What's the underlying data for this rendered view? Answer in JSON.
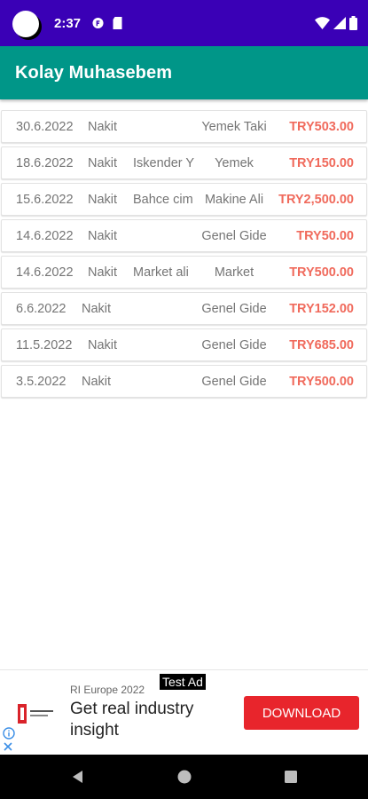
{
  "status_bar": {
    "time": "2:37",
    "icons": [
      "avatar",
      "circle-f-icon",
      "sd-card-icon",
      "wifi-icon",
      "signal-icon",
      "battery-icon"
    ]
  },
  "app_bar": {
    "title": "Kolay Muhasebem",
    "background": "#009688"
  },
  "transactions": [
    {
      "date": "30.6.2022",
      "type": "Nakit",
      "description": "",
      "category": "Yemek Taki",
      "amount": "TRY503.00"
    },
    {
      "date": "18.6.2022",
      "type": "Nakit",
      "description": "Iskender Y",
      "category": "Yemek",
      "amount": "TRY150.00"
    },
    {
      "date": "15.6.2022",
      "type": "Nakit",
      "description": "Bahce cim",
      "category": "Makine Ali",
      "amount": "TRY2,500.00"
    },
    {
      "date": "14.6.2022",
      "type": "Nakit",
      "description": "",
      "category": "Genel Gide",
      "amount": "TRY50.00"
    },
    {
      "date": "14.6.2022",
      "type": "Nakit",
      "description": "Market ali",
      "category": "Market",
      "amount": "TRY500.00"
    },
    {
      "date": "6.6.2022",
      "type": "Nakit",
      "description": "",
      "category": "Genel Gide",
      "amount": "TRY152.00"
    },
    {
      "date": "11.5.2022",
      "type": "Nakit",
      "description": "",
      "category": "Genel Gide",
      "amount": "TRY685.00"
    },
    {
      "date": "3.5.2022",
      "type": "Nakit",
      "description": "",
      "category": "Genel Gide",
      "amount": "TRY500.00"
    }
  ],
  "ad": {
    "badge": "Test Ad",
    "sponsor": "RI Europe 2022",
    "headline": "Get real industry insight",
    "button": "DOWNLOAD",
    "button_color": "#e8252c"
  },
  "colors": {
    "status_bar": "#3a00b6",
    "amount": "#f06a5c"
  }
}
